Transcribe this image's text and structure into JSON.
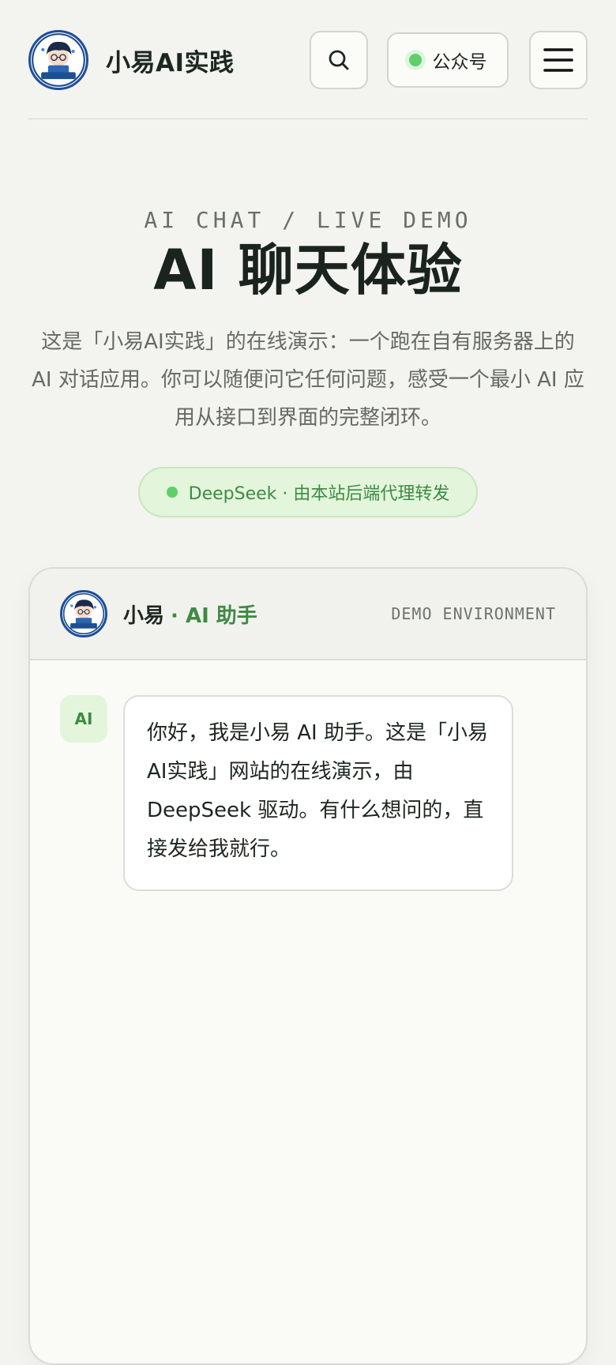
{
  "header": {
    "brand_name": "小易AI实践",
    "wechat_label": "公众号",
    "icons": [
      "logo-avatar",
      "search-icon",
      "status-dot-icon",
      "hamburger-menu-icon"
    ]
  },
  "hero": {
    "eyebrow": "AI CHAT / LIVE DEMO",
    "title": "AI 聊天体验",
    "description": "这是「小易AI实践」的在线演示：一个跑在自有服务器上的 AI 对话应用。你可以随便问它任何问题，感受一个最小 AI 应用从接口到界面的完整闭环。",
    "model_pill": "DeepSeek · 由本站后端代理转发"
  },
  "chat": {
    "assistant_name": "小易",
    "assistant_role": "· AI 助手",
    "environment": "DEMO ENVIRONMENT",
    "messages": [
      {
        "sender_badge": "AI",
        "text": "你好，我是小易 AI 助手。这是「小易AI实践」网站的在线演示，由 DeepSeek 驱动。有什么想问的，直接发给我就行。"
      }
    ]
  },
  "colors": {
    "accent_green": "#3f8a45",
    "status_green": "#5fcf6a",
    "logo_blue": "#1e4f95",
    "background": "#f3f3ef"
  }
}
